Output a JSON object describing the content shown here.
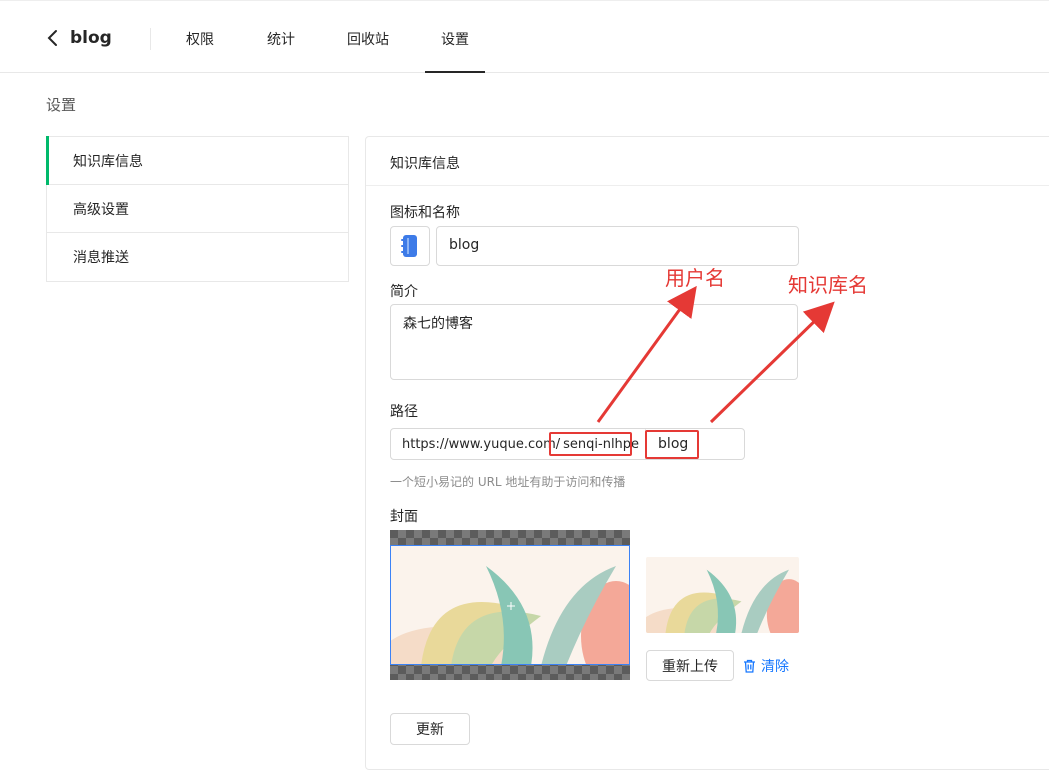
{
  "header": {
    "back_title": "blog",
    "tabs": [
      {
        "label": "权限"
      },
      {
        "label": "统计"
      },
      {
        "label": "回收站"
      },
      {
        "label": "设置"
      }
    ]
  },
  "page": {
    "title": "设置"
  },
  "sidebar": {
    "items": [
      {
        "label": "知识库信息",
        "active": true
      },
      {
        "label": "高级设置"
      },
      {
        "label": "消息推送"
      }
    ]
  },
  "panel": {
    "title": "知识库信息",
    "icon_name_label": "图标和名称",
    "name_value": "blog",
    "desc_label": "简介",
    "desc_value": "森七的博客",
    "path_label": "路径",
    "path_prefix": "https://www.yuque.com/",
    "path_user": "senqi-nlhpe",
    "path_slug": "blog",
    "path_hint": "一个短小易记的 URL 地址有助于访问和传播",
    "cover_label": "封面",
    "reupload_label": "重新上传",
    "clear_label": "清除",
    "update_label": "更新"
  },
  "annotations": {
    "username": "用户名",
    "repo_name": "知识库名"
  },
  "colors": {
    "accent_green": "#00b96b",
    "annotation_red": "#e53935",
    "link_blue": "#1677ff"
  }
}
